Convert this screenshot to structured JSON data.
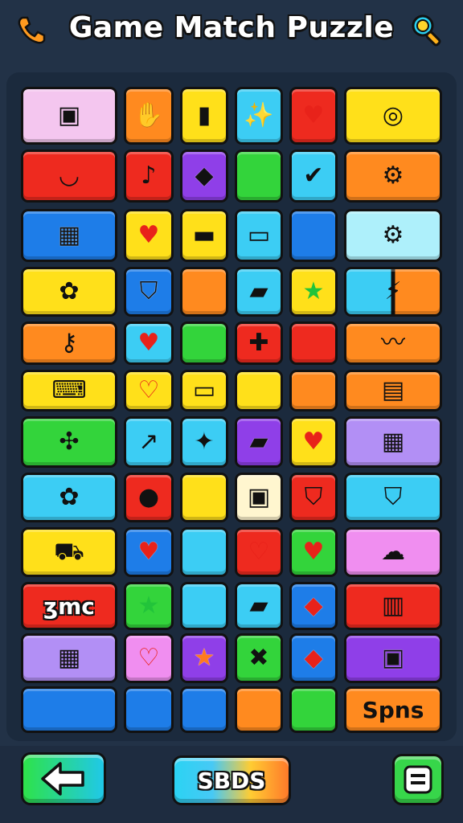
{
  "title": "Game Match Puzzle",
  "header": {
    "left_icon": "phone-icon",
    "right_icon": "search-icon"
  },
  "colors": {
    "background": "#223247",
    "pink": "#f4c6ef",
    "orange": "#ff8a1f",
    "yellow": "#ffe01a",
    "cyan": "#3ccdf4",
    "red": "#ee2a1f",
    "purple": "#8f3fe8",
    "green": "#33d43b",
    "blue": "#1e7de8",
    "lightblue": "#aef0fb",
    "lavender": "#b28ff5",
    "magenta": "#f08ef0"
  },
  "rows": [
    [
      {
        "color": "pink",
        "icon": "id-card-icon",
        "glyph": "▣"
      },
      {
        "color": "orange",
        "icon": "hand-icon",
        "glyph": "✋"
      },
      {
        "color": "yellow",
        "icon": "battery-icon",
        "glyph": "▮"
      },
      {
        "color": "cyan",
        "icon": "wand-icon",
        "glyph": "✨"
      },
      {
        "color": "red",
        "icon": "heart-icon",
        "glyph": "♥"
      },
      {
        "color": "yellow",
        "icon": "ring-icon",
        "glyph": "◎"
      }
    ],
    [
      {
        "color": "red",
        "icon": "smile-icon",
        "glyph": "◡"
      },
      {
        "color": "red",
        "icon": "music-note-icon",
        "glyph": "♪"
      },
      {
        "color": "purple",
        "icon": "gem-icon",
        "glyph": "◆"
      },
      {
        "color": "green",
        "icon": "",
        "glyph": ""
      },
      {
        "color": "cyan",
        "icon": "check-icon",
        "glyph": "✔"
      },
      {
        "color": "orange",
        "icon": "gears-icon",
        "glyph": "⚙"
      }
    ],
    [
      {
        "color": "blue",
        "icon": "robot-icon",
        "glyph": "▦"
      },
      {
        "color": "yellow",
        "icon": "heart-icon",
        "glyph": "♥"
      },
      {
        "color": "yellow",
        "icon": "bandage-icon",
        "glyph": "▬"
      },
      {
        "color": "cyan",
        "icon": "battery-icon",
        "glyph": "▭"
      },
      {
        "color": "blue",
        "icon": "",
        "glyph": ""
      },
      {
        "color": "lightblue",
        "icon": "gear-icon",
        "glyph": "⚙"
      }
    ],
    [
      {
        "color": "yellow",
        "icon": "bee-icon",
        "glyph": "✿"
      },
      {
        "color": "blue",
        "icon": "shield-icon",
        "glyph": "⛉"
      },
      {
        "color": "orange",
        "icon": "",
        "glyph": ""
      },
      {
        "color": "cyan",
        "icon": "bottle-icon",
        "glyph": "▰"
      },
      {
        "color": "yellow",
        "icon": "star-icon",
        "glyph": "★"
      },
      {
        "color": "split",
        "icon": "lightning-diamond-icon",
        "glyph": "⚡"
      }
    ],
    [
      {
        "color": "orange",
        "icon": "key-icon",
        "glyph": "⚷"
      },
      {
        "color": "cyan",
        "icon": "heart-icon",
        "glyph": "♥"
      },
      {
        "color": "green",
        "icon": "",
        "glyph": ""
      },
      {
        "color": "red",
        "icon": "plus-icon",
        "glyph": "✚"
      },
      {
        "color": "red",
        "icon": "",
        "glyph": ""
      },
      {
        "color": "orange",
        "icon": "wave-icon",
        "glyph": "〰"
      }
    ],
    [
      {
        "color": "yellow",
        "icon": "gamepad-icon",
        "glyph": "⌨"
      },
      {
        "color": "yellow",
        "icon": "heart-icon",
        "glyph": "♡"
      },
      {
        "color": "yellow",
        "icon": "card-icon",
        "glyph": "▭"
      },
      {
        "color": "yellow",
        "icon": "",
        "glyph": ""
      },
      {
        "color": "orange",
        "icon": "",
        "glyph": ""
      },
      {
        "color": "orange",
        "icon": "window-icon",
        "glyph": "▤"
      }
    ],
    [
      {
        "color": "green",
        "icon": "bow-icon",
        "glyph": "✣"
      },
      {
        "color": "cyan",
        "icon": "arrow-icon",
        "glyph": "↗"
      },
      {
        "color": "cyan",
        "icon": "leaf-icon",
        "glyph": "✦"
      },
      {
        "color": "purple",
        "icon": "bottle-icon",
        "glyph": "▰"
      },
      {
        "color": "yellow",
        "icon": "heart-icon",
        "glyph": "♥"
      },
      {
        "color": "lavender",
        "icon": "panel-icon",
        "glyph": "▦"
      }
    ],
    [
      {
        "color": "cyan",
        "icon": "cracker-icon",
        "glyph": "✿"
      },
      {
        "color": "red",
        "icon": "face-icon",
        "glyph": "●"
      },
      {
        "color": "yellow",
        "icon": "",
        "glyph": ""
      },
      {
        "color": "cream",
        "icon": "cheese-icon",
        "glyph": "▣"
      },
      {
        "color": "red",
        "icon": "shield-icon",
        "glyph": "⛉"
      },
      {
        "color": "cyan",
        "icon": "shield-face-icon",
        "glyph": "⛉"
      }
    ],
    [
      {
        "color": "yellow",
        "icon": "car-icon",
        "glyph": "⛟"
      },
      {
        "color": "blue",
        "icon": "heart-icon",
        "glyph": "♥"
      },
      {
        "color": "cyan",
        "icon": "",
        "glyph": ""
      },
      {
        "color": "red",
        "icon": "heart-icon",
        "glyph": "♡"
      },
      {
        "color": "green",
        "icon": "heart-icon",
        "glyph": "♥"
      },
      {
        "color": "magenta",
        "icon": "cloud-icon",
        "glyph": "☁"
      }
    ],
    [
      {
        "color": "red",
        "icon": "",
        "glyph": "",
        "text": "ʒmc"
      },
      {
        "color": "green",
        "icon": "star-icon",
        "glyph": "★"
      },
      {
        "color": "cyan",
        "icon": "",
        "glyph": ""
      },
      {
        "color": "cyan",
        "icon": "bottle-icon",
        "glyph": "▰"
      },
      {
        "color": "blue",
        "icon": "diamond-icon",
        "glyph": "◆"
      },
      {
        "color": "red",
        "icon": "film-icon",
        "glyph": "▥"
      }
    ],
    [
      {
        "color": "lavender",
        "icon": "robot-icon",
        "glyph": "▦"
      },
      {
        "color": "magenta",
        "icon": "heart-icon",
        "glyph": "♡"
      },
      {
        "color": "purple",
        "icon": "star-icon",
        "glyph": "★"
      },
      {
        "color": "green",
        "icon": "cross-icon",
        "glyph": "✖"
      },
      {
        "color": "blue",
        "icon": "diamond-icon",
        "glyph": "◆"
      },
      {
        "color": "purple",
        "icon": "camera-icon",
        "glyph": "▣"
      }
    ],
    [
      {
        "color": "blue",
        "icon": "",
        "glyph": ""
      },
      {
        "color": "blue",
        "icon": "",
        "glyph": ""
      },
      {
        "color": "blue",
        "icon": "",
        "glyph": ""
      },
      {
        "color": "orange",
        "icon": "",
        "glyph": ""
      },
      {
        "color": "green",
        "icon": "",
        "glyph": ""
      },
      {
        "color": "orange",
        "icon": "",
        "glyph": "",
        "text": "Spns"
      }
    ]
  ],
  "footer": {
    "back_icon": "arrow-left-icon",
    "score_label": "SBDS",
    "menu_icon": "menu-icon"
  }
}
